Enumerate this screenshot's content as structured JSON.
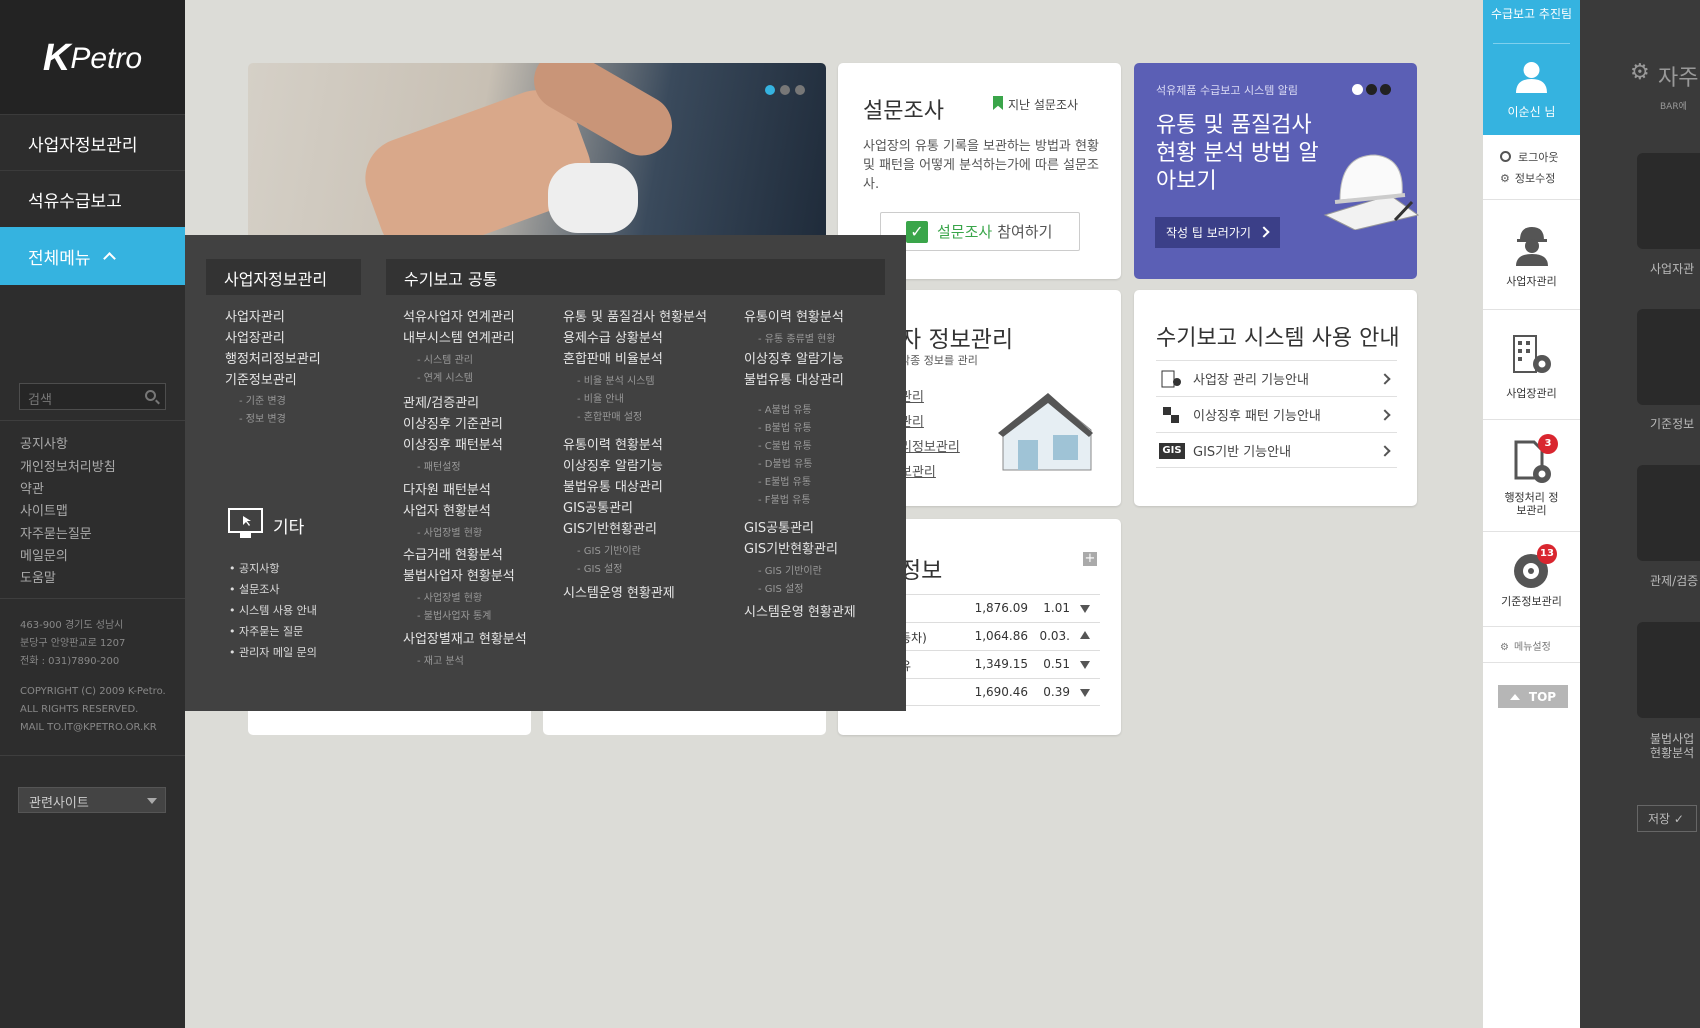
{
  "brand": {
    "logo_k": "K",
    "logo_text": "Petro"
  },
  "sidebar": {
    "nav": [
      {
        "label": "사업자정보관리"
      },
      {
        "label": "석유수급보고"
      },
      {
        "label": "전체메뉴"
      }
    ],
    "search_placeholder": "검색",
    "links": [
      "공지사항",
      "개인정보처리방침",
      "약관",
      "사이트맵",
      "자주묻는질문",
      "메일문의",
      "도움말"
    ],
    "address": [
      "463-900 경기도 성남시",
      "분당구 안양판교로 1207",
      "전화 : 031)7890-200"
    ],
    "copyright": [
      "COPYRIGHT (C) 2009 K-Petro.",
      "ALL RIGHTS RESERVED.",
      "MAIL TO.IT@KPETRO.OR.KR"
    ],
    "related": "관련사이트"
  },
  "survey": {
    "title": "설문조사",
    "past": "지난 설문조사",
    "desc": "사업장의 유통 기록을 보관하는 방법과 현황 및 패턴을 어떻게 분석하는가에 따른 설문조사.",
    "btn_highlight": "설문조사",
    "btn_rest": "참여하기"
  },
  "promo": {
    "small": "석유제품 수급보고 시스템 알림",
    "title": "유통 및 품질검사 현황 분석 방법 알아보기",
    "btn": "작성 팁 보러가기"
  },
  "biz": {
    "title": "자 정보관리",
    "sub": "각종 정보를 관리",
    "links": [
      "관리",
      "관리",
      "리정보관리",
      "보관리"
    ]
  },
  "guide": {
    "title": "수기보고 시스템 사용 안내",
    "rows": [
      "사업장 관리 기능안내",
      "이상징후 패턴 기능안내",
      "GIS기반 기능안내"
    ],
    "gis_label": "GIS"
  },
  "market": {
    "title": "정보",
    "plus": "+",
    "rows": [
      {
        "name": "",
        "v1": "1,876.09",
        "v2": "1.01",
        "dir": "down"
      },
      {
        "name": "동차)",
        "v1": "1,064.86",
        "v2": "0.03.",
        "dir": "up"
      },
      {
        "name": "유",
        "v1": "1,349.15",
        "v2": "0.51",
        "dir": "down"
      },
      {
        "name": "",
        "v1": "1,690.46",
        "v2": "0.39",
        "dir": "down"
      }
    ]
  },
  "mega": {
    "head1": "사업자정보관리",
    "head2": "수기보고 공통",
    "col1": [
      "사업자관리",
      "사업장관리",
      "행정처리정보관리",
      "기준정보관리"
    ],
    "col1_sub": [
      "- 기준 변경",
      "- 정보 변경"
    ],
    "etc_title": "기타",
    "etc": [
      "• 공지사항",
      "• 설문조사",
      "• 시스템 사용 안내",
      "• 자주묻는 질문",
      "• 관리자 메일 문의"
    ],
    "c2": {
      "l1": "석유사업자 연계관리",
      "l2": "내부시스템 연계관리",
      "s1": "- 시스템 관리",
      "s2": "- 연계 시스템",
      "l3": "관제/검증관리",
      "l4": "이상징후 기준관리",
      "l5": "이상징후 패턴분석",
      "s3": "- 패턴설정",
      "l6": "다자원 패턴분석",
      "l7": "사업자 현황분석",
      "s4": "- 사업장별 현황",
      "l8": "수급거래 현황분석",
      "l9": "불법사업자 현황분석",
      "s5": "- 사업장별 현황",
      "s6": "- 불법사업자 통계",
      "l10": "사업장별재고 현황분석",
      "s7": "- 재고 분석"
    },
    "c3": {
      "l1": "유통 및 품질검사 현황분석",
      "l2": "용제수급 상황분석",
      "l3": "혼합판매 비율분석",
      "s1": "- 비율 분석 시스템",
      "s2": "- 비율 안내",
      "s3": "- 혼합판매 설정",
      "l4": "유통이력 현황분석",
      "l5": "이상징후 알람기능",
      "l6": "불법유통 대상관리",
      "l7": "GIS공통관리",
      "l8": "GIS기반현황관리",
      "s4": "- GIS 기반이란",
      "s5": "- GIS 설정",
      "l9": "시스템운영 현황관제"
    },
    "c4": {
      "l1": "유통이력 현황분석",
      "s1": "- 유통 종류별 현황",
      "l2": "이상징후 알람기능",
      "l3": "불법유통 대상관리",
      "s2": "- A불법 유통",
      "s3": "- B불법 유통",
      "s4": "- C불법 유통",
      "s5": "- D불법 유통",
      "s6": "- E불법 유통",
      "s7": "- F불법 유통",
      "l4": "GIS공통관리",
      "l5": "GIS기반현황관리",
      "s8": "- GIS 기반이란",
      "s9": "- GIS 설정",
      "l6": "시스템운영 현황관제"
    }
  },
  "right": {
    "team": "수급보고 추진팀",
    "user": "이순신 님",
    "logout": "로그아웃",
    "edit": "정보수정",
    "items": [
      {
        "label": "사업자관리"
      },
      {
        "label": "사업장관리"
      },
      {
        "label": "행정처리 정보관리",
        "badge": "3"
      },
      {
        "label": "기준정보관리",
        "badge": "13"
      }
    ],
    "menu_settings": "메뉴설정",
    "top": "TOP"
  },
  "farright": {
    "title": "자주",
    "sub": "BAR에",
    "labels": [
      "사업자관",
      "기준정보",
      "관제/검증",
      "불법사업",
      "현황분석"
    ],
    "save": "저장"
  },
  "colors": {
    "accent": "#35b3e0",
    "promo": "#5b5fb5",
    "survey_green": "#3aa54a",
    "badge": "#d9262f"
  }
}
